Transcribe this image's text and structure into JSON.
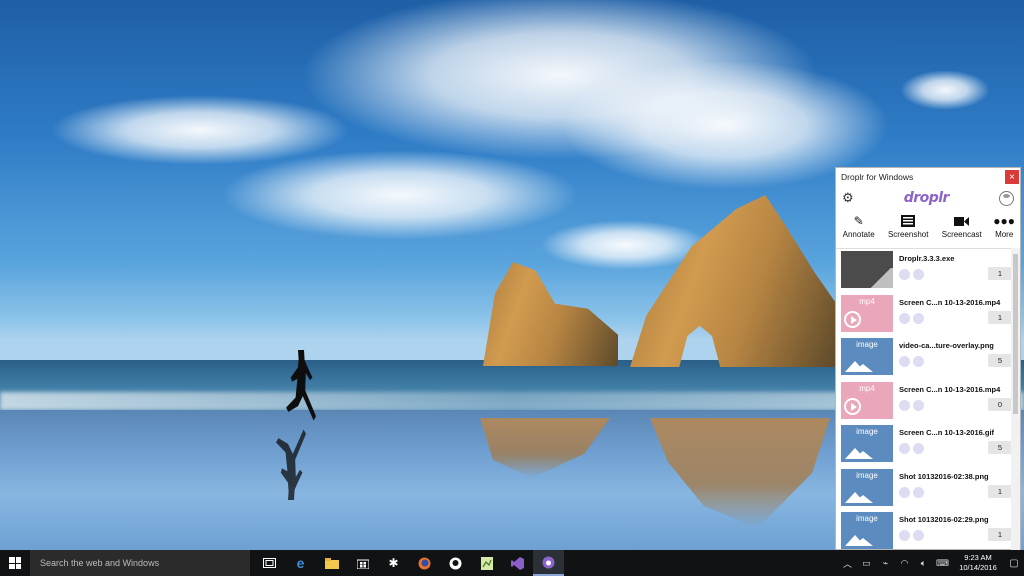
{
  "app": {
    "window_title": "Droplr for Windows",
    "close_glyph": "×",
    "logo": "droplr",
    "settings_icon": "gear-icon",
    "account_icon": "avatar-icon"
  },
  "toolbar": {
    "annotate": "Annotate",
    "screenshot": "Screenshot",
    "screencast": "Screencast",
    "more": "More"
  },
  "files": [
    {
      "type": "file",
      "label": "",
      "name": "Droplr.3.3.3.exe",
      "count": "1"
    },
    {
      "type": "mp4",
      "label": "mp4",
      "name": "Screen C...n 10-13-2016.mp4",
      "count": "1"
    },
    {
      "type": "image",
      "label": "image",
      "name": "video-ca...ture-overlay.png",
      "count": "5"
    },
    {
      "type": "mp4",
      "label": "mp4",
      "name": "Screen C...n 10-13-2016.mp4",
      "count": "0"
    },
    {
      "type": "image",
      "label": "image",
      "name": "Screen C...n 10-13-2016.gif",
      "count": "5"
    },
    {
      "type": "image",
      "label": "image",
      "name": "Shot 10132016-02:38.png",
      "count": "1"
    },
    {
      "type": "image",
      "label": "image",
      "name": "Shot 10132016-02:29.png",
      "count": "1"
    }
  ],
  "taskbar": {
    "search_placeholder": "Search the web and Windows",
    "time": "9:23 AM",
    "date": "10/14/2016",
    "apps": [
      "task-view-icon",
      "edge-icon",
      "file-explorer-icon",
      "store-icon",
      "slack-icon",
      "firefox-icon",
      "github-icon",
      "notepad-icon",
      "visual-studio-icon",
      "droplr-icon"
    ]
  },
  "colors": {
    "accent": "#8b63c9",
    "close": "#d93a3a",
    "mp4": "#e9a7b9",
    "image": "#5b8bbf",
    "file": "#4b4b4b",
    "taskbar": "#101214"
  }
}
